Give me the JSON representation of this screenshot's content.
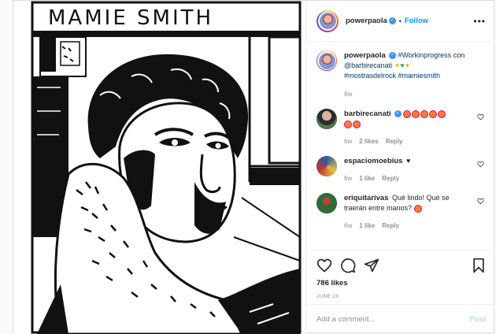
{
  "image": {
    "title_text": "MAMIE SMITH"
  },
  "header": {
    "username": "powerpaola",
    "follow_label": "Follow",
    "more_icon": "more-horizontal-icon"
  },
  "caption": {
    "username": "powerpaola",
    "hashtag1": "#Workinprogress",
    "text1": " con ",
    "mention": "@barbirecanati",
    "hashtag2": "#mostrasdelrock",
    "hashtag3": "#mamiesmith",
    "time": "6w"
  },
  "comments": [
    {
      "username": "barbirecanati",
      "text": "",
      "time": "6w",
      "likes": "2 likes",
      "reply": "Reply"
    },
    {
      "username": "espaciomoebius",
      "text": "♥",
      "time": "6w",
      "likes": "1 like",
      "reply": "Reply"
    },
    {
      "username": "eriquitarivas",
      "text": "Qué lindo! Qué se traerán entre manos?",
      "time": "6w",
      "likes": "1 like",
      "reply": "Reply"
    }
  ],
  "actions": {
    "likes_count": "786 likes",
    "date": "JUNE 28"
  },
  "add_comment": {
    "placeholder": "Add a comment...",
    "post_label": "Post"
  },
  "colors": {
    "accent": "#0095f6",
    "verified": "#3897f0",
    "muted": "#8e8e8e"
  }
}
